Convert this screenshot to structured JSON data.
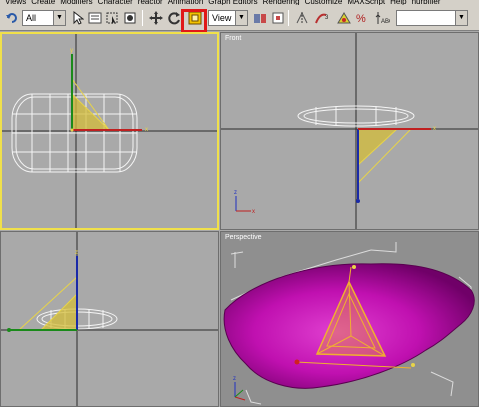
{
  "menu": {
    "items": [
      "Views",
      "Create",
      "Modifiers",
      "Character",
      "reactor",
      "Animation",
      "Graph Editors",
      "Rendering",
      "Customize",
      "MAXScript",
      "Help",
      "nurbfiler"
    ]
  },
  "toolbar": {
    "selection_filter": "All",
    "reference_coord": "View",
    "named_selection": "",
    "highlighted_tool": "select-and-manipulate"
  },
  "viewports": {
    "top_left_label": "",
    "top_right_label": "Front",
    "bottom_left_label": "",
    "bottom_right_label": "Perspective"
  },
  "colors": {
    "highlight": "#e01818",
    "active_border": "#f0e04a",
    "object_magenta": "#cc10b8",
    "wire": "#ffffff",
    "light_cone": "#d8c23a"
  }
}
